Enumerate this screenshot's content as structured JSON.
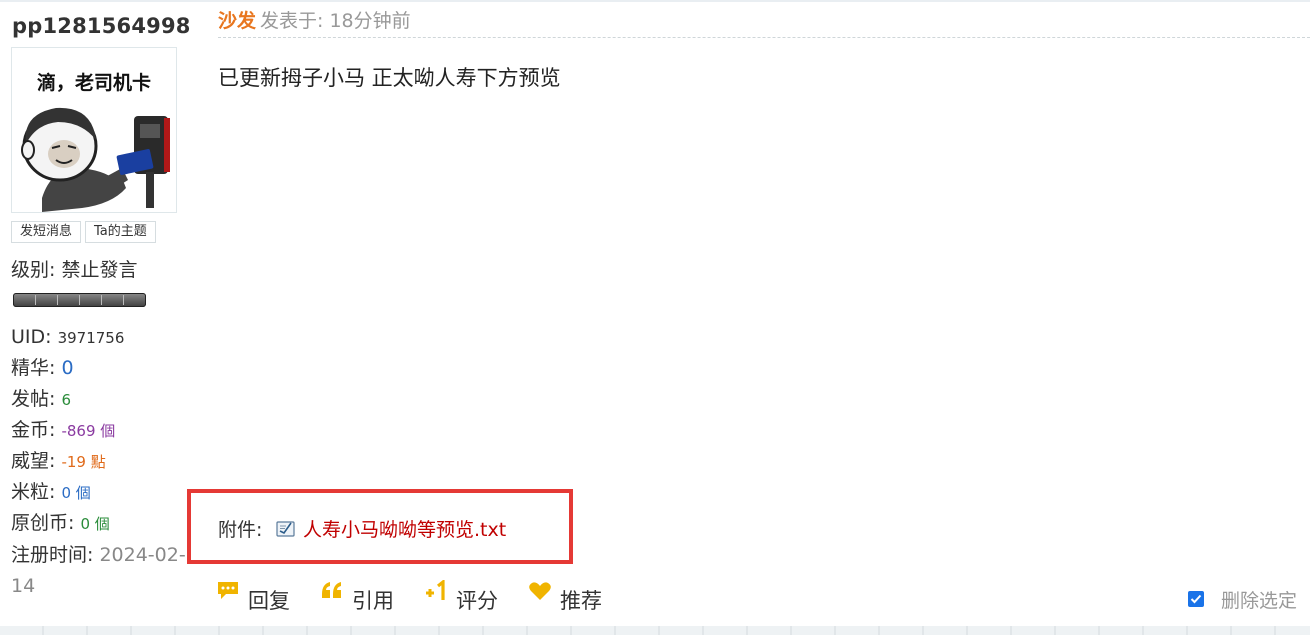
{
  "user": {
    "username": "pp1281564998",
    "avatar_caption": "滴，老司机卡",
    "buttons": [
      "发短消息",
      "Ta的主题"
    ],
    "level_label": "级别: 禁止發言",
    "stats": {
      "uid_label": "UID: ",
      "uid": "3971756",
      "digest_label": "精华: ",
      "digest": "0",
      "posts_label": "发帖: ",
      "posts": "6",
      "gold_label": "金币: ",
      "gold": "-869 個",
      "prestige_label": "威望: ",
      "prestige": "-19 點",
      "rice_label": "米粒: ",
      "rice": "0 個",
      "original_coins_label": "原创币: ",
      "original_coins": "0 個",
      "reg_time_label": "注册时间: ",
      "reg_time": "2024-02-14"
    }
  },
  "post": {
    "floor": "沙发",
    "posted_at": "发表于: 18分钟前",
    "content": "已更新拇子小马 正太呦人寿下方预览",
    "attachment_label": "附件: ",
    "attachment_name": "人寿小马呦呦等预览.txt"
  },
  "actions": [
    "回复",
    "引用",
    "评分",
    "推荐"
  ],
  "delete_selected": "删除选定",
  "colors": {
    "floor": "#e8761f",
    "attachment_link": "#c00000",
    "highlight_box": "#e53935",
    "checkbox": "#1a73e8"
  }
}
